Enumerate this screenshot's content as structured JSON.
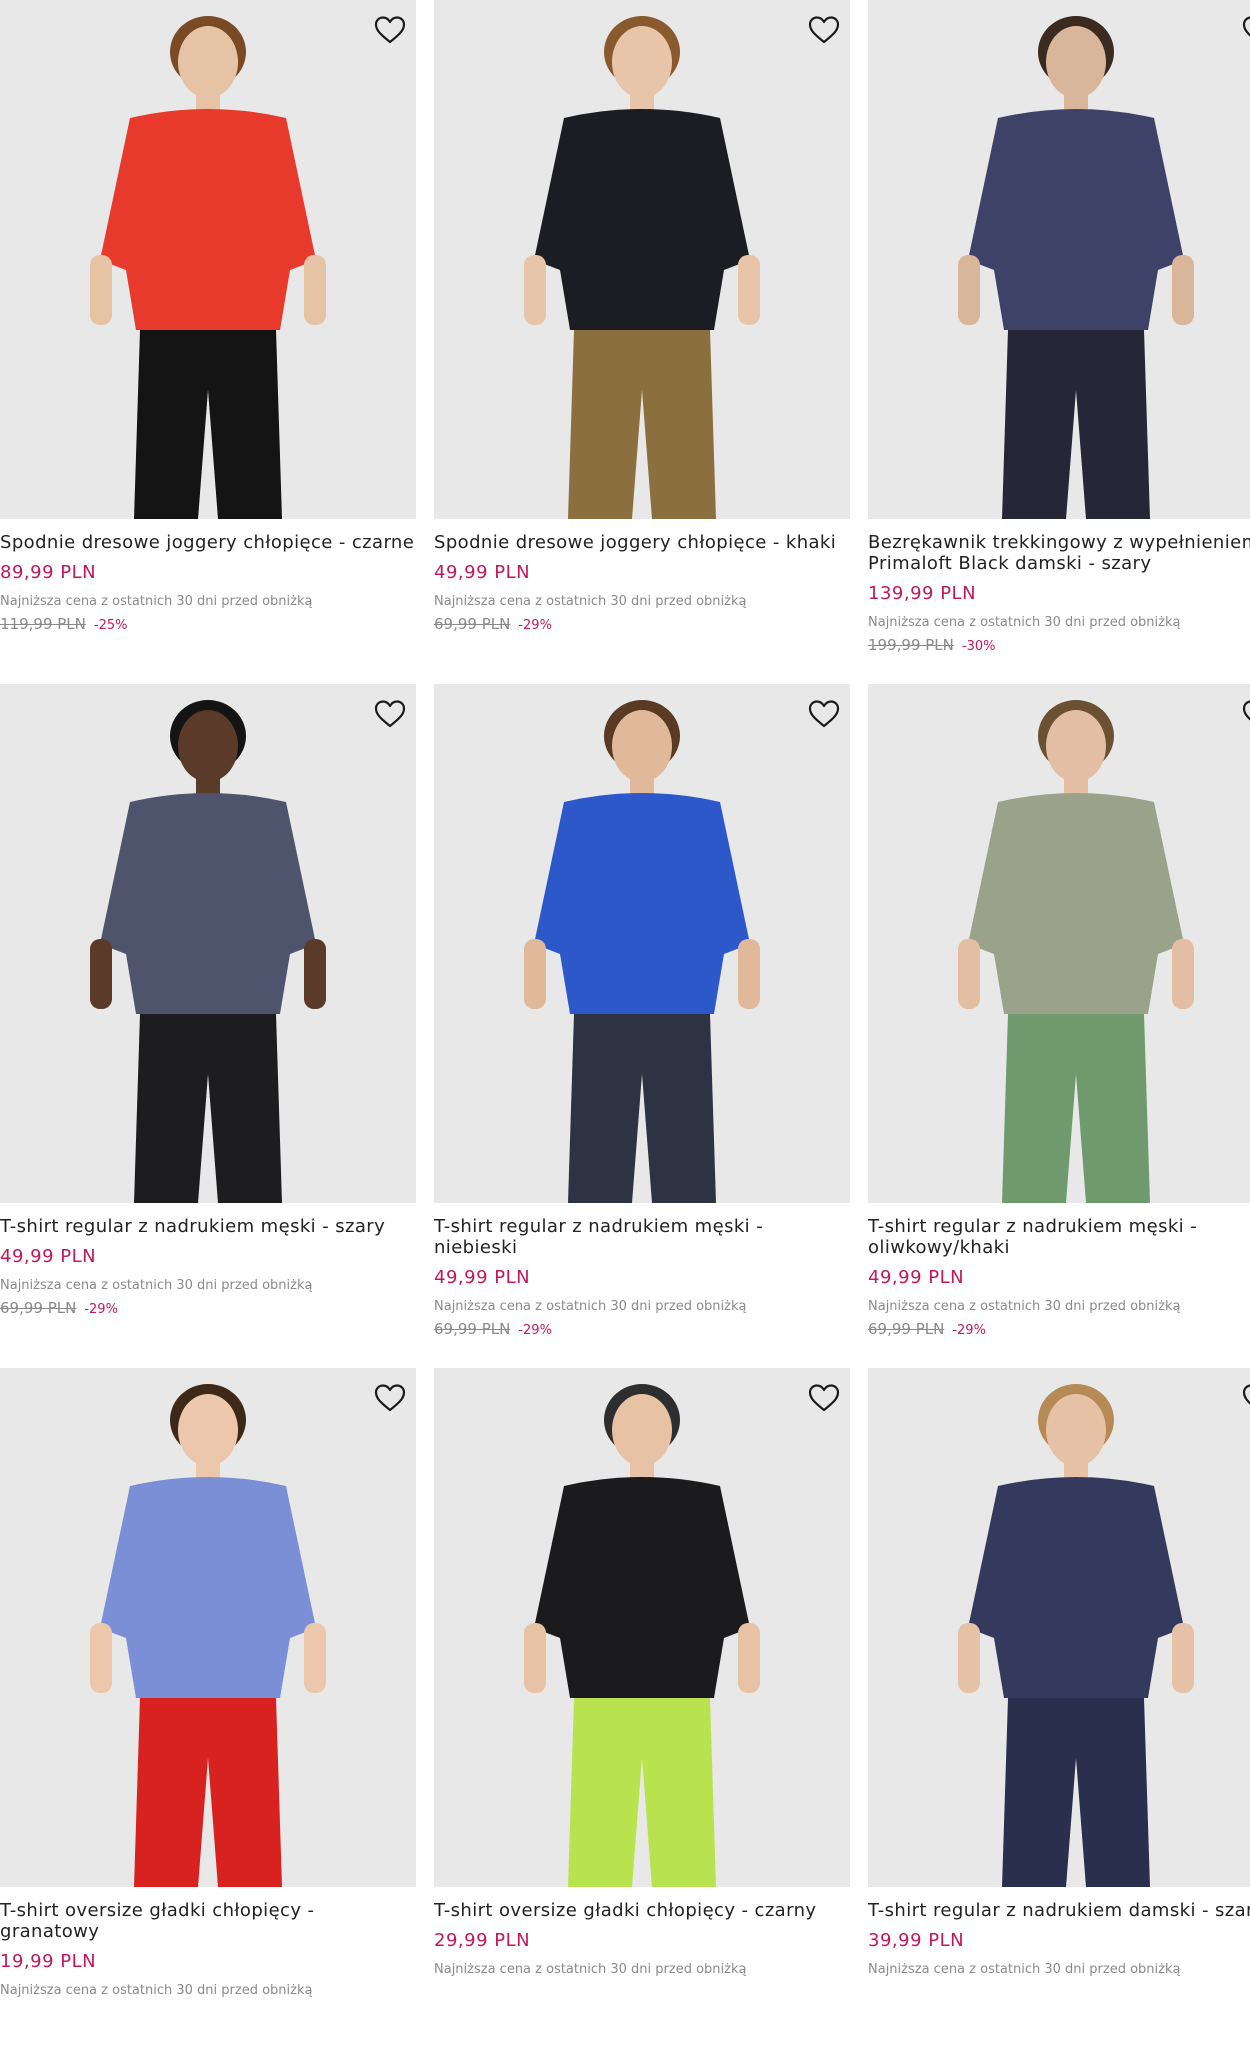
{
  "products": [
    {
      "name": "Spodnie dresowe joggery chłopięce - czarne",
      "price": "89,99 PLN",
      "lowest_label": "Najniższa cena z ostatnich 30 dni przed obniżką",
      "old_price": "119,99 PLN",
      "discount": "-25%",
      "top_color": "#e83a2c",
      "bottom_color": "#141414",
      "skin": "#e7c3a6",
      "hair": "#7a4a25"
    },
    {
      "name": "Spodnie dresowe joggery chłopięce - khaki",
      "price": "49,99 PLN",
      "lowest_label": "Najniższa cena z ostatnich 30 dni przed obniżką",
      "old_price": "69,99 PLN",
      "discount": "-29%",
      "top_color": "#1b1d22",
      "bottom_color": "#8b6f3e",
      "skin": "#e8c4a8",
      "hair": "#8a5a2f"
    },
    {
      "name": "Bezrękawnik trekkingowy z wypełnieniem Primaloft Black damski - szary",
      "price": "139,99 PLN",
      "lowest_label": "Najniższa cena z ostatnich 30 dni przed obniżką",
      "old_price": "199,99 PLN",
      "discount": "-30%",
      "top_color": "#3f4268",
      "bottom_color": "#262636",
      "skin": "#d9b59a",
      "hair": "#3a2a20"
    },
    {
      "name": "T-shirt regular z nadrukiem męski - szary",
      "price": "49,99 PLN",
      "lowest_label": "Najniższa cena z ostatnich 30 dni przed obniżką",
      "old_price": "69,99 PLN",
      "discount": "-29%",
      "top_color": "#4d546c",
      "bottom_color": "#1d1d1f",
      "skin": "#5a3a28",
      "hair": "#141414"
    },
    {
      "name": "T-shirt regular z nadrukiem męski - niebieski",
      "price": "49,99 PLN",
      "lowest_label": "Najniższa cena z ostatnich 30 dni przed obniżką",
      "old_price": "69,99 PLN",
      "discount": "-29%",
      "top_color": "#2d58c9",
      "bottom_color": "#2e3344",
      "skin": "#e0b99a",
      "hair": "#5a3a22"
    },
    {
      "name": "T-shirt regular z nadrukiem męski - oliwkowy/khaki",
      "price": "49,99 PLN",
      "lowest_label": "Najniższa cena z ostatnich 30 dni przed obniżką",
      "old_price": "69,99 PLN",
      "discount": "-29%",
      "top_color": "#9aa38a",
      "bottom_color": "#6f9a6e",
      "skin": "#e3bea2",
      "hair": "#6b5032"
    },
    {
      "name": "T-shirt oversize gładki chłopięcy - granatowy",
      "price": "19,99 PLN",
      "lowest_label": "Najniższa cena z ostatnich 30 dni przed obniżką",
      "old_price": "",
      "discount": "",
      "top_color": "#7b8fd6",
      "bottom_color": "#d8221f",
      "skin": "#ecc7ac",
      "hair": "#3e2818"
    },
    {
      "name": "T-shirt oversize gładki chłopięcy - czarny",
      "price": "29,99 PLN",
      "lowest_label": "Najniższa cena z ostatnich 30 dni przed obniżką",
      "old_price": "",
      "discount": "",
      "top_color": "#1b1b1d",
      "bottom_color": "#b8e34f",
      "skin": "#e8c2a4",
      "hair": "#2e2e30"
    },
    {
      "name": "T-shirt regular z nadrukiem damski - szary",
      "price": "39,99 PLN",
      "lowest_label": "Najniższa cena z ostatnich 30 dni przed obniżką",
      "old_price": "",
      "discount": "",
      "top_color": "#343a5e",
      "bottom_color": "#2a2f4d",
      "skin": "#e6c1a5",
      "hair": "#b58a55"
    }
  ],
  "icons": {
    "favorite": "heart-outline-icon"
  }
}
